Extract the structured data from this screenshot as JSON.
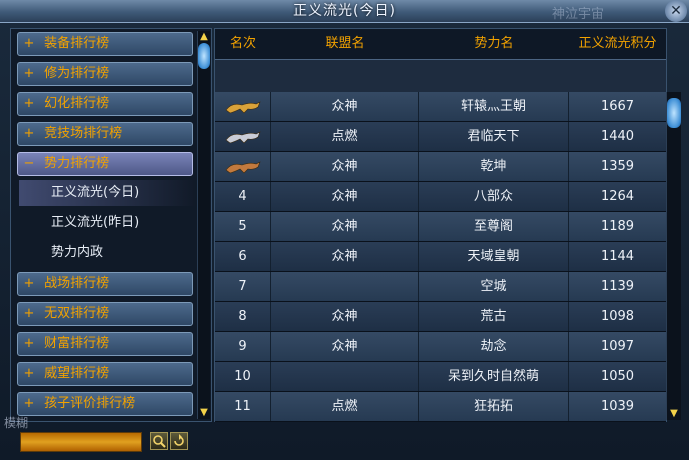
{
  "window": {
    "title": "正义流光(今日)",
    "watermark": "神泣宇宙",
    "close_icon": "close-icon"
  },
  "sidebar": {
    "categories": [
      {
        "label": "装备排行榜",
        "expanded": false
      },
      {
        "label": "修为排行榜",
        "expanded": false
      },
      {
        "label": "幻化排行榜",
        "expanded": false
      },
      {
        "label": "竞技场排行榜",
        "expanded": false
      },
      {
        "label": "势力排行榜",
        "expanded": true
      }
    ],
    "subitems": [
      {
        "label": "正义流光(今日)",
        "selected": true
      },
      {
        "label": "正义流光(昨日)",
        "selected": false
      },
      {
        "label": "势力内政",
        "selected": false
      }
    ],
    "categories_after": [
      {
        "label": "战场排行榜"
      },
      {
        "label": "无双排行榜"
      },
      {
        "label": "财富排行榜"
      },
      {
        "label": "威望排行榜"
      },
      {
        "label": "孩子评价排行榜"
      }
    ],
    "plus_symbol": "+",
    "minus_symbol": "−"
  },
  "table": {
    "headers": [
      "名次",
      "联盟名",
      "势力名",
      "正义流光积分"
    ],
    "rows": [
      {
        "rank": "",
        "rank_icon": "gold-tiger-icon",
        "alliance": "众神",
        "faction": "轩辕灬王朝",
        "score": "1667"
      },
      {
        "rank": "",
        "rank_icon": "silver-tiger-icon",
        "alliance": "点燃",
        "faction": "君临天下",
        "score": "1440"
      },
      {
        "rank": "",
        "rank_icon": "bronze-tiger-icon",
        "alliance": "众神",
        "faction": "乾坤",
        "score": "1359"
      },
      {
        "rank": "4",
        "rank_icon": "",
        "alliance": "众神",
        "faction": "八部众",
        "score": "1264"
      },
      {
        "rank": "5",
        "rank_icon": "",
        "alliance": "众神",
        "faction": "至尊阁",
        "score": "1189"
      },
      {
        "rank": "6",
        "rank_icon": "",
        "alliance": "众神",
        "faction": "天域皇朝",
        "score": "1144"
      },
      {
        "rank": "7",
        "rank_icon": "",
        "alliance": "",
        "faction": "空城",
        "score": "1139"
      },
      {
        "rank": "8",
        "rank_icon": "",
        "alliance": "众神",
        "faction": "荒古",
        "score": "1098"
      },
      {
        "rank": "9",
        "rank_icon": "",
        "alliance": "众神",
        "faction": "劫念",
        "score": "1097"
      },
      {
        "rank": "10",
        "rank_icon": "",
        "alliance": "",
        "faction": "呆到久时自然萌",
        "score": "1050"
      },
      {
        "rank": "11",
        "rank_icon": "",
        "alliance": "点燃",
        "faction": "狂拓拓",
        "score": "1039"
      }
    ]
  },
  "search": {
    "label": "模糊",
    "value": "",
    "placeholder": "",
    "search_icon": "magnifier-icon",
    "reset_icon": "refresh-icon"
  },
  "colors": {
    "header_text": "#f2a200",
    "row_text": "#eef2f8",
    "sidebar_text": "#f2a200",
    "gold": "#d9a23a",
    "silver": "#c9ccd6",
    "bronze": "#c27a3e"
  }
}
